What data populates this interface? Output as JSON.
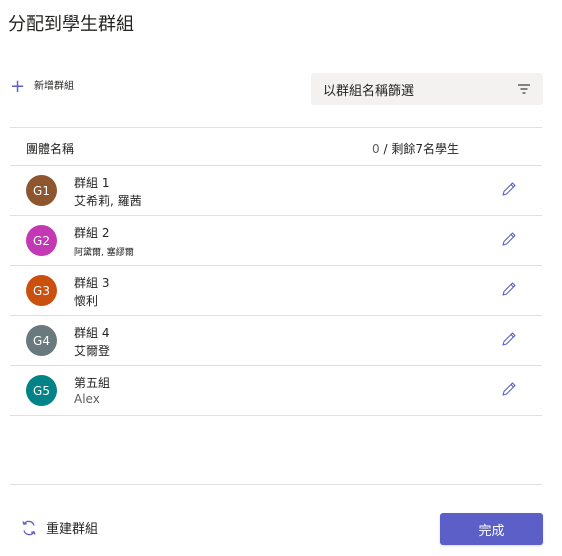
{
  "title": "分配到學生群組",
  "add_group": {
    "label": "新增群組"
  },
  "filter": {
    "placeholder": "以群組名稱篩選"
  },
  "table_header": {
    "name_col": "團體名稱",
    "count_zero": "0",
    "count_rest": " / 剩餘7名學生"
  },
  "groups": [
    {
      "initials": "G1",
      "name": "群組 1",
      "members": "艾希莉, 羅茜",
      "color": "#8e562e"
    },
    {
      "initials": "G2",
      "name": "群組 2",
      "members": "阿黛爾, 塞繆爾",
      "color": "#c239b3"
    },
    {
      "initials": "G3",
      "name": "群組 3",
      "members": "懷利",
      "color": "#ca5010"
    },
    {
      "initials": "G4",
      "name": "群組 4",
      "members": "艾爾登",
      "color": "#69797e"
    },
    {
      "initials": "G5",
      "name": "第五組",
      "members": "Alex",
      "color": "#038387"
    }
  ],
  "footer": {
    "regroup_label": "重建群組",
    "done_label": "完成"
  },
  "colors": {
    "accent": "#5b5fc7",
    "divider": "#e1dfdd",
    "filter_bg": "#f3f2f1"
  }
}
